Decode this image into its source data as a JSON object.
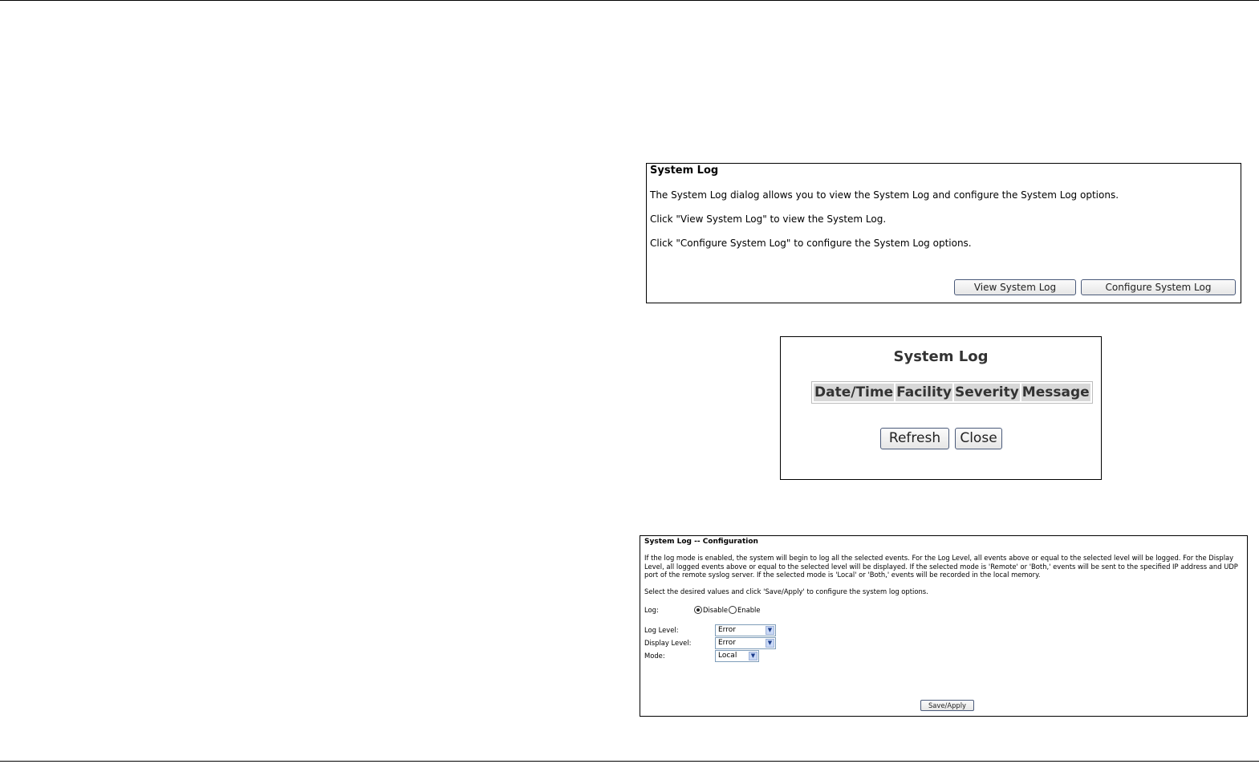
{
  "panel1": {
    "title": "System Log",
    "line1": "The System Log dialog allows you to view the System Log and configure the System Log options.",
    "line2": "Click \"View System Log\" to view the System Log.",
    "line3": "Click \"Configure System Log\" to configure the System Log options.",
    "view_button": "View System Log",
    "configure_button": "Configure System Log"
  },
  "panel2": {
    "title": "System Log",
    "columns": [
      "Date/Time",
      "Facility",
      "Severity",
      "Message"
    ],
    "refresh_button": "Refresh",
    "close_button": "Close"
  },
  "panel3": {
    "title": "System Log -- Configuration",
    "description": "If the log mode is enabled, the system will begin to log all the selected events. For the Log Level, all events above or equal to the selected level will be logged. For the Display Level, all logged events above or equal to the selected level will be displayed. If the selected mode is 'Remote' or 'Both,' events will be sent to the specified IP address and UDP port of the remote syslog server. If the selected mode is 'Local' or 'Both,' events will be recorded in the local memory.",
    "instruction": "Select the desired values and click 'Save/Apply' to configure the system log options.",
    "log_label": "Log:",
    "disable_label": "Disable",
    "enable_label": "Enable",
    "log_level_label": "Log Level:",
    "log_level_value": "Error",
    "display_level_label": "Display Level:",
    "display_level_value": "Error",
    "mode_label": "Mode:",
    "mode_value": "Local",
    "save_button": "Save/Apply"
  },
  "icons": {
    "dropdown": "chevron-down-icon",
    "radio_selected": "radio-selected-icon",
    "radio_empty": "radio-empty-icon"
  }
}
